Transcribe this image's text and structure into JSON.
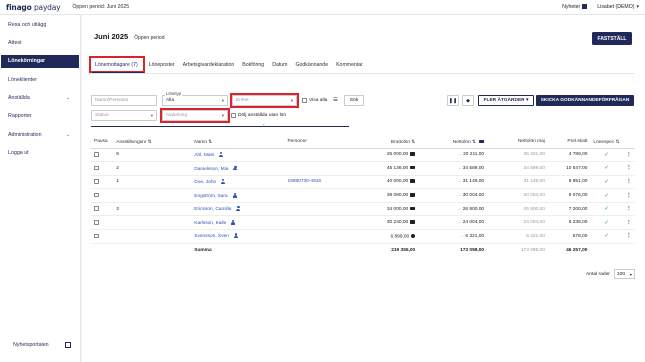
{
  "topbar": {
    "logo_main": "finago",
    "logo_sub": "payday",
    "period": "Öppen period: Juni 2025",
    "news": "Nyheter",
    "user": "Lisabet (DEMO)"
  },
  "sidebar": {
    "items": [
      {
        "label": "Resa och utlägg"
      },
      {
        "label": "Attest"
      },
      {
        "label": "Lönekörningar"
      },
      {
        "label": "Löneklienter"
      },
      {
        "label": "Anställda"
      },
      {
        "label": "Rapporter"
      },
      {
        "label": "Administration"
      },
      {
        "label": "Logga ut"
      }
    ],
    "news_portal": "Nyhetsportalen"
  },
  "main": {
    "title": "Juni 2025",
    "status": "Öppen period",
    "finalize": "FASTSTÄLL",
    "tabs": [
      "Lönemottagare (7)",
      "Löneposter",
      "Arbetsgivardeklaration",
      "Bokföring",
      "Datum",
      "Godkännande",
      "Kommentar"
    ]
  },
  "filters": {
    "name_placeholder": "Namn/Personnr",
    "payroll_label": "Lönetyp",
    "payroll_value": "Alla",
    "unit_placeholder": "Enhet",
    "show_all": "Visa alla",
    "search": "Sök",
    "status_placeholder": "Status",
    "department_placeholder": "Avdelning",
    "hide_no_salary": "Dölj anställda utan lön"
  },
  "actions": {
    "more": "FLER ÅTGÄRDER",
    "send": "SKICKA GODKÄNNANDEFÖRFRÅGAN"
  },
  "table": {
    "headers": [
      "Pausa",
      "Anställningsnr",
      "Namn",
      "Personnr",
      "Bruttolön",
      "Nettolön",
      "Nettolön maj",
      "Prel.skatt",
      "Lönespec"
    ],
    "rows": [
      {
        "nr": "6",
        "name": "Ahl, Mats",
        "personnr": "",
        "brutto": "25 000,00",
        "netto": "20 211,00",
        "netto_maj": "35 331,00",
        "skatt": "4 789,00"
      },
      {
        "nr": "2",
        "name": "Danielsson, Mia",
        "personnr": "",
        "brutto": "45 136,00",
        "netto": "34 589,00",
        "netto_maj": "34 589,00",
        "skatt": "10 547,00"
      },
      {
        "nr": "1",
        "name": "Doe, John",
        "personnr": "19950730-4916",
        "brutto": "40 000,00",
        "netto": "31 149,00",
        "netto_maj": "31 149,00",
        "skatt": "8 851,00"
      },
      {
        "nr": "",
        "name": "Engström, Sara",
        "personnr": "",
        "brutto": "38 080,00",
        "netto": "30 004,00",
        "netto_maj": "30 004,00",
        "skatt": "8 076,00"
      },
      {
        "nr": "3",
        "name": "Ericsson, Camilla",
        "personnr": "",
        "brutto": "34 000,00",
        "netto": "26 800,00",
        "netto_maj": "26 800,00",
        "skatt": "7 200,00"
      },
      {
        "nr": "",
        "name": "Karlsson, Kalle",
        "personnr": "",
        "brutto": "30 240,00",
        "netto": "24 004,00",
        "netto_maj": "24 004,00",
        "skatt": "6 236,00"
      },
      {
        "nr": "",
        "name": "Svensson, Sven",
        "personnr": "",
        "brutto": "6 899,00",
        "netto": "6 321,00",
        "netto_maj": "6 321,00",
        "skatt": "578,00"
      }
    ],
    "sum_label": "Summa",
    "sum_brutto": "219 355,00",
    "sum_netto": "173 098,00",
    "sum_netto_maj": "173 098,00",
    "sum_skatt": "46 257,00"
  },
  "footer": {
    "rows_label": "Antal rader",
    "rows_value": "100"
  },
  "colors": {
    "primary": "#1f2a5a",
    "highlight": "#d9232d",
    "link": "#2b56b8",
    "check": "#1a9b4b"
  }
}
